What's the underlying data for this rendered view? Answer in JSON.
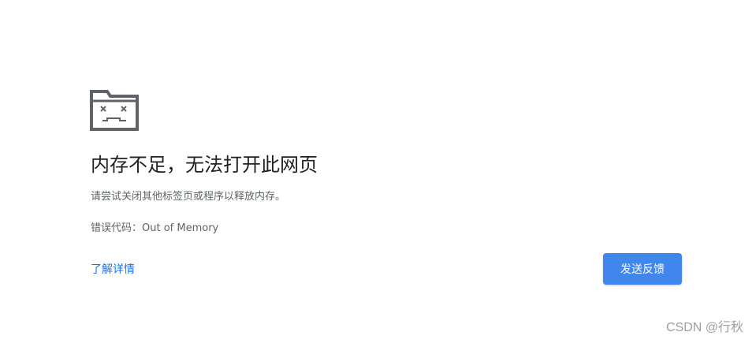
{
  "error": {
    "icon": "sad-folder-icon",
    "title": "内存不足，无法打开此网页",
    "message": "请尝试关闭其他标签页或程序以释放内存。",
    "code": "错误代码：Out of Memory"
  },
  "actions": {
    "details_label": "了解详情",
    "feedback_label": "发送反馈"
  },
  "watermark": {
    "text": "CSDN @行秋"
  },
  "colors": {
    "link": "#1a73e8",
    "button": "#3f87ec",
    "icon": "#5f6368"
  }
}
